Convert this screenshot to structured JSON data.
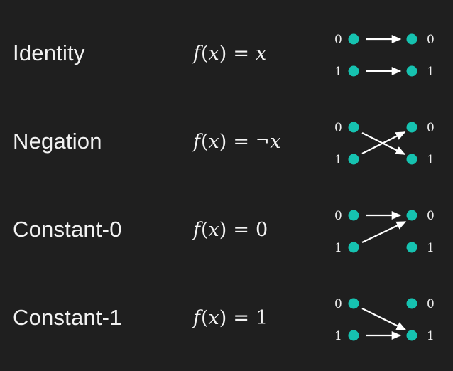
{
  "background_color": "#1f1f1f",
  "dot_color": "#16c2b0",
  "arrow_color": "#ffffff",
  "text_color": "#f2f2f2",
  "diagram": {
    "input_labels": [
      "0",
      "1"
    ],
    "output_labels": [
      "0",
      "1"
    ]
  },
  "rows": [
    {
      "name": "Identity",
      "formula": {
        "fn": "f",
        "open": "(",
        "arg": "x",
        "close": ")",
        "eq": "=",
        "not": "",
        "rhs": "x",
        "rhs_is_variable": true,
        "text": "f(x) = x"
      },
      "mapping": [
        {
          "from": "0",
          "to": "0"
        },
        {
          "from": "1",
          "to": "1"
        }
      ]
    },
    {
      "name": "Negation",
      "formula": {
        "fn": "f",
        "open": "(",
        "arg": "x",
        "close": ")",
        "eq": "=",
        "not": "¬",
        "rhs": "x",
        "rhs_is_variable": true,
        "text": "f(x) = ¬x"
      },
      "mapping": [
        {
          "from": "0",
          "to": "1"
        },
        {
          "from": "1",
          "to": "0"
        }
      ]
    },
    {
      "name": "Constant-0",
      "formula": {
        "fn": "f",
        "open": "(",
        "arg": "x",
        "close": ")",
        "eq": "=",
        "not": "",
        "rhs": "0",
        "rhs_is_variable": false,
        "text": "f(x) = 0"
      },
      "mapping": [
        {
          "from": "0",
          "to": "0"
        },
        {
          "from": "1",
          "to": "0"
        }
      ]
    },
    {
      "name": "Constant-1",
      "formula": {
        "fn": "f",
        "open": "(",
        "arg": "x",
        "close": ")",
        "eq": "=",
        "not": "",
        "rhs": "1",
        "rhs_is_variable": false,
        "text": "f(x) = 1"
      },
      "mapping": [
        {
          "from": "0",
          "to": "1"
        },
        {
          "from": "1",
          "to": "1"
        }
      ]
    }
  ]
}
